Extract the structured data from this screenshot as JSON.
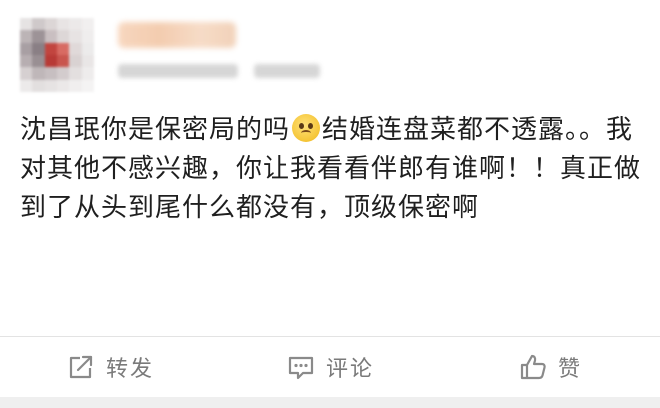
{
  "post": {
    "segments": [
      {
        "type": "text",
        "value": "沈昌珉你是保密局的吗"
      },
      {
        "type": "emoji",
        "icon": "pleading-face-emoji"
      },
      {
        "type": "text",
        "value": "结婚连盘菜都不透露。。我对其他不感兴趣，你让我看看伴郎有谁啊！！真正做到了从头到尾什么都没有，顶级保密啊"
      }
    ]
  },
  "actions": {
    "repost_label": "转发",
    "comment_label": "评论",
    "like_label": "赞"
  },
  "colors": {
    "text": "#1f1f1f",
    "action_text": "#7a7a7a",
    "divider": "#e3e3e3"
  }
}
